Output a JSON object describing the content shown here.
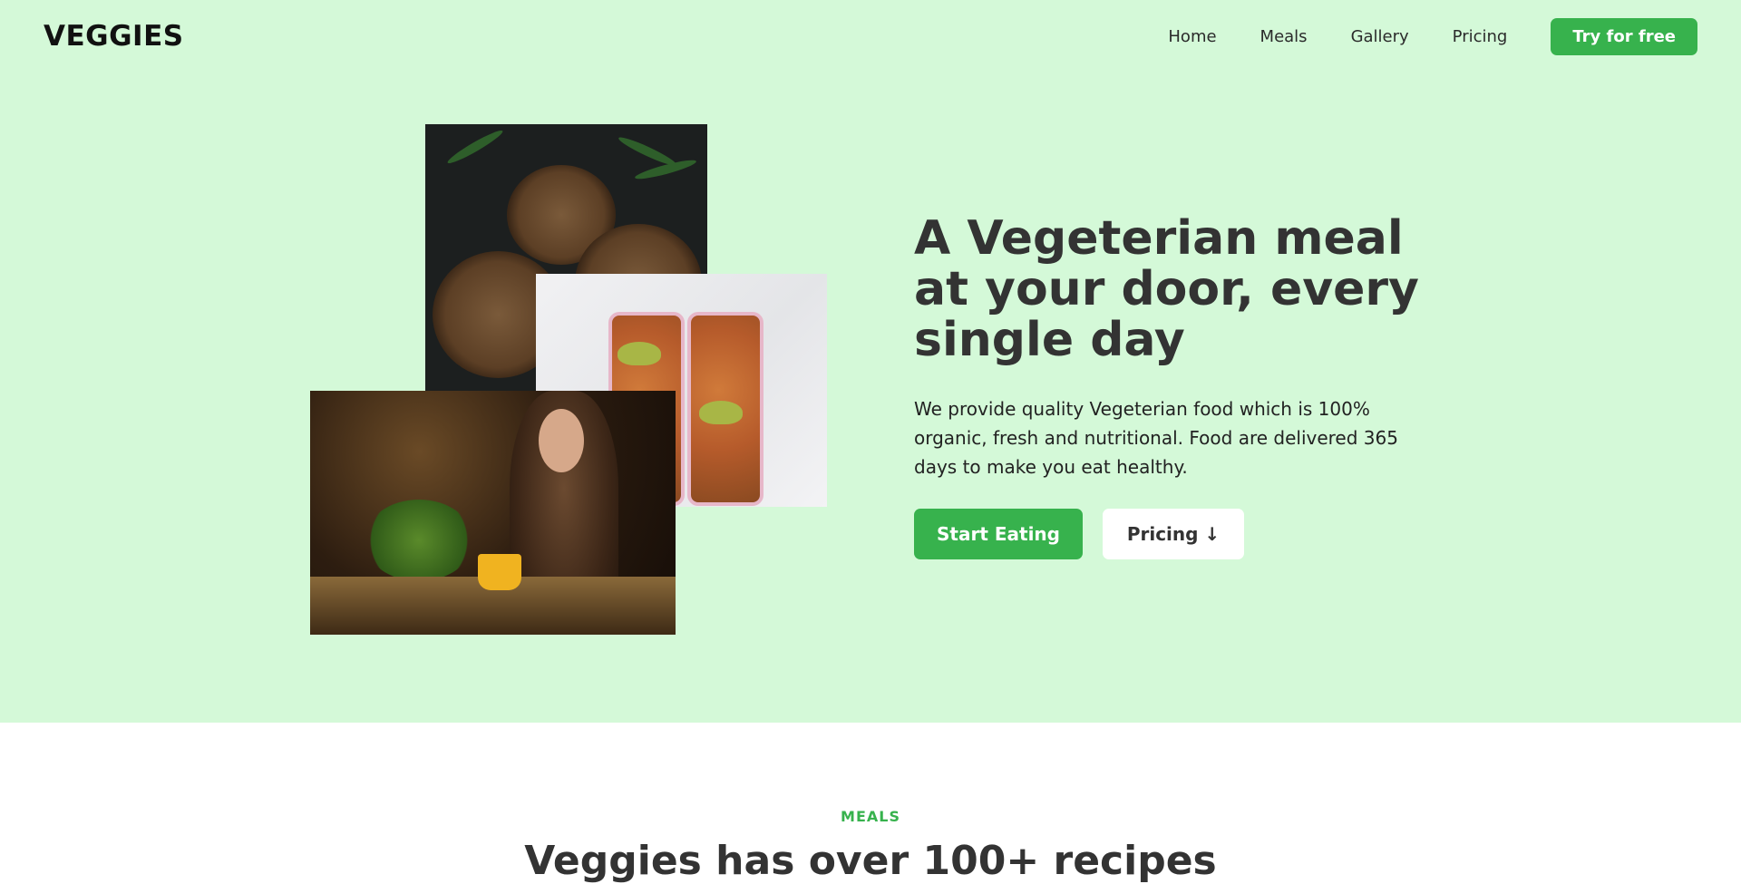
{
  "brand": {
    "logo": "VEGGIES",
    "accent_color": "#37b24d",
    "hero_bg": "#d4f9d8"
  },
  "nav": {
    "items": [
      {
        "label": "Home"
      },
      {
        "label": "Meals"
      },
      {
        "label": "Gallery"
      },
      {
        "label": "Pricing"
      }
    ],
    "cta_label": "Try for free"
  },
  "hero": {
    "headline": "A Vegeterian meal at your door, every single day",
    "description": "We provide quality Vegeterian food which is 100% organic, fresh and nutritional. Food are delivered 365 days to make you eat healthy.",
    "primary_button": "Start Eating",
    "secondary_button": "Pricing ↓",
    "images": [
      {
        "name": "bowls-photo",
        "desc_icon": "food-bowls-image"
      },
      {
        "name": "meal-boxes-photo",
        "desc_icon": "meal-prep-image"
      },
      {
        "name": "woman-eating-photo",
        "desc_icon": "dining-image"
      }
    ]
  },
  "meals_section": {
    "label": "MEALS",
    "title": "Veggies has over 100+ recipes"
  }
}
